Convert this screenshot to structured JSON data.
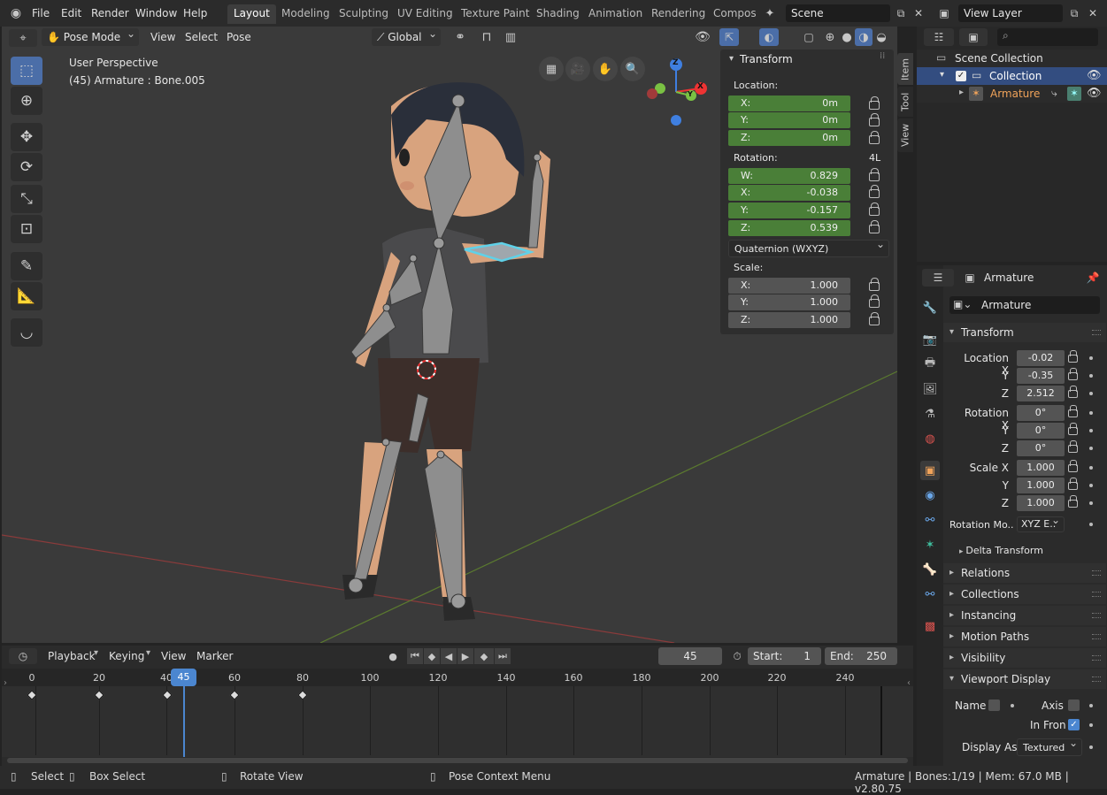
{
  "menus": {
    "file": "File",
    "edit": "Edit",
    "render": "Render",
    "window": "Window",
    "help": "Help"
  },
  "workspaces": [
    "Layout",
    "Modeling",
    "Sculpting",
    "UV Editing",
    "Texture Paint",
    "Shading",
    "Animation",
    "Rendering",
    "Compos"
  ],
  "scene": {
    "name": "Scene",
    "view_layer": "View Layer"
  },
  "viewport_header": {
    "mode": "Pose Mode",
    "view": "View",
    "select": "Select",
    "pose": "Pose",
    "orientation": "Global"
  },
  "viewport_overlay": {
    "perspective": "User Perspective",
    "active": "(45) Armature : Bone.005"
  },
  "gizmo": {
    "z": "Z",
    "x": "X",
    "y": "Y"
  },
  "npanel": {
    "title": "Transform",
    "location_label": "Location:",
    "location": [
      {
        "k": "X:",
        "v": "0m"
      },
      {
        "k": "Y:",
        "v": "0m"
      },
      {
        "k": "Z:",
        "v": "0m"
      }
    ],
    "rotation_label": "Rotation:",
    "rotation_flag": "4L",
    "rotation": [
      {
        "k": "W:",
        "v": "0.829"
      },
      {
        "k": "X:",
        "v": "-0.038"
      },
      {
        "k": "Y:",
        "v": "-0.157"
      },
      {
        "k": "Z:",
        "v": "0.539"
      }
    ],
    "rotation_mode": "Quaternion (WXYZ)",
    "scale_label": "Scale:",
    "scale": [
      {
        "k": "X:",
        "v": "1.000"
      },
      {
        "k": "Y:",
        "v": "1.000"
      },
      {
        "k": "Z:",
        "v": "1.000"
      }
    ],
    "tabs": [
      "Item",
      "Tool",
      "View"
    ]
  },
  "timeline": {
    "playback": "Playback",
    "keying": "Keying",
    "view": "View",
    "marker": "Marker",
    "current_frame": "45",
    "start_label": "Start:",
    "start": "1",
    "end_label": "End:",
    "end": "250",
    "ticks": [
      "0",
      "20",
      "40",
      "60",
      "80",
      "100",
      "120",
      "140",
      "160",
      "180",
      "200",
      "220",
      "240"
    ],
    "playhead": "45"
  },
  "outliner": {
    "scene_collection": "Scene Collection",
    "collection": "Collection",
    "armature": "Armature"
  },
  "properties": {
    "object_name": "Armature",
    "datablock": "Armature",
    "transform_title": "Transform",
    "location": [
      {
        "k": "Location X",
        "v": "-0.02"
      },
      {
        "k": "Y",
        "v": "-0.35"
      },
      {
        "k": "Z",
        "v": "2.512"
      }
    ],
    "rotation": [
      {
        "k": "Rotation X",
        "v": "0°"
      },
      {
        "k": "Y",
        "v": "0°"
      },
      {
        "k": "Z",
        "v": "0°"
      }
    ],
    "scale": [
      {
        "k": "Scale X",
        "v": "1.000"
      },
      {
        "k": "Y",
        "v": "1.000"
      },
      {
        "k": "Z",
        "v": "1.000"
      }
    ],
    "rotation_mode_label": "Rotation Mo..",
    "rotation_mode": "XYZ E..",
    "delta": "Delta Transform",
    "sections": [
      "Relations",
      "Collections",
      "Instancing",
      "Motion Paths",
      "Visibility"
    ],
    "viewport_display": "Viewport Display",
    "name_label": "Name",
    "axis_label": "Axis",
    "in_front_label": "In Fron",
    "display_as_label": "Display As",
    "display_as": "Textured"
  },
  "status": {
    "select": "Select",
    "box_select": "Box Select",
    "rotate_view": "Rotate View",
    "context_menu": "Pose Context Menu",
    "info": "Armature | Bones:1/19 | Mem: 67.0 MB | v2.80.75"
  }
}
